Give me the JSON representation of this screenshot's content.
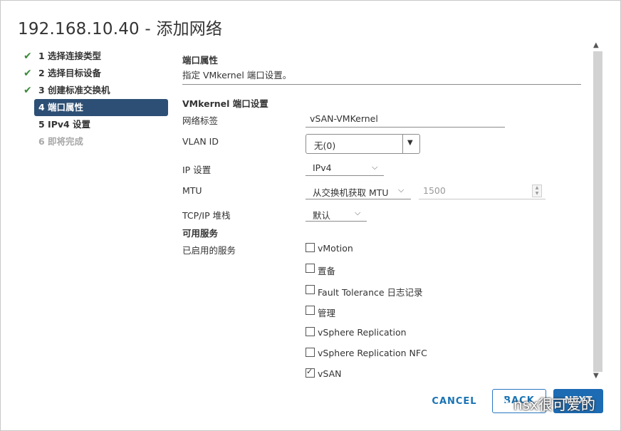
{
  "dialog": {
    "title": "192.168.10.40 - 添加网络"
  },
  "steps": [
    {
      "label": "1 选择连接类型",
      "state": "done"
    },
    {
      "label": "2 选择目标设备",
      "state": "done"
    },
    {
      "label": "3 创建标准交换机",
      "state": "done"
    },
    {
      "label": "4 端口属性",
      "state": "active"
    },
    {
      "label": "5 IPv4 设置",
      "state": "pending"
    },
    {
      "label": "6 即将完成",
      "state": "disabled"
    }
  ],
  "content": {
    "section_title": "端口属性",
    "section_desc": "指定 VMkernel 端口设置。",
    "vmk_title": "VMkernel 端口设置",
    "network_label": {
      "label": "网络标签",
      "value": "vSAN-VMKernel"
    },
    "vlan": {
      "label": "VLAN ID",
      "value": "无(0)"
    },
    "ip": {
      "label": "IP 设置",
      "value": "IPv4"
    },
    "mtu": {
      "label": "MTU",
      "value": "从交换机获取 MTU",
      "number_placeholder": "1500"
    },
    "tcpip": {
      "label": "TCP/IP 堆栈",
      "value": "默认"
    },
    "services_title": "可用服务",
    "services_label": "已启用的服务",
    "services": [
      {
        "label": "vMotion",
        "checked": false
      },
      {
        "label": "置备",
        "checked": false
      },
      {
        "label": "Fault Tolerance 日志记录",
        "checked": false
      },
      {
        "label": "管理",
        "checked": false
      },
      {
        "label": "vSphere Replication",
        "checked": false
      },
      {
        "label": "vSphere Replication NFC",
        "checked": false
      },
      {
        "label": "vSAN",
        "checked": true
      }
    ]
  },
  "footer": {
    "cancel": "CANCEL",
    "back": "BACK",
    "next": "NEXT"
  },
  "watermark": "nsx很可爱的",
  "icons": {
    "check": "check-icon",
    "dropdown": "chevron-down-icon",
    "spinner": "stepper-icon"
  },
  "colors": {
    "accent": "#2d4f75",
    "primary": "#1c6bb3",
    "check": "#3a8a3a"
  }
}
